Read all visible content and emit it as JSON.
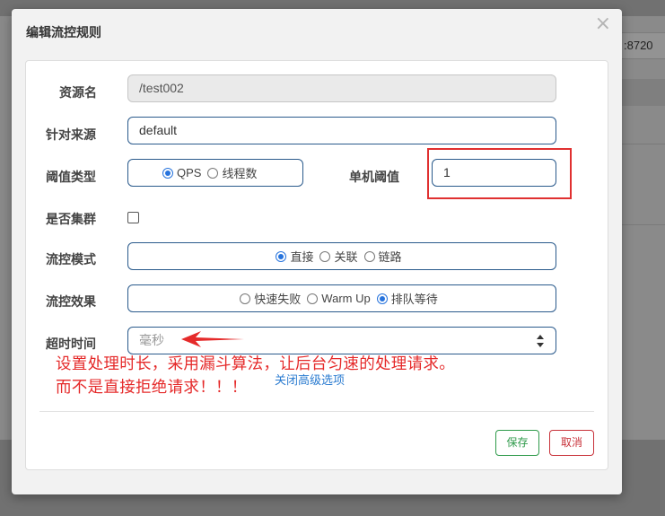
{
  "background": {
    "address_fragment": ":8720"
  },
  "dialog": {
    "title": "编辑流控规则",
    "close_glyph": "×",
    "fields": {
      "resource_name": {
        "label": "资源名",
        "value": "/test002"
      },
      "limit_app": {
        "label": "针对来源",
        "value": "default"
      },
      "grade": {
        "label": "阈值类型",
        "options": [
          "QPS",
          "线程数"
        ],
        "selected": "QPS"
      },
      "count": {
        "label": "单机阈值",
        "value": "1"
      },
      "cluster": {
        "label": "是否集群",
        "checked": false
      },
      "strategy": {
        "label": "流控模式",
        "options": [
          "直接",
          "关联",
          "链路"
        ],
        "selected": "直接"
      },
      "control_behavior": {
        "label": "流控效果",
        "options": [
          "快速失败",
          "Warm Up",
          "排队等待"
        ],
        "selected": "排队等待"
      },
      "timeout": {
        "label": "超时时间",
        "placeholder": "毫秒"
      }
    },
    "annotation_lines": [
      "设置处理时长，采用漏斗算法，让后台匀速的处理请求。",
      "而不是直接拒绝请求！！！"
    ],
    "advanced_link": "关闭高级选项",
    "buttons": {
      "save": "保存",
      "cancel": "取消"
    }
  },
  "colors": {
    "annotation_red": "#e52a2a",
    "radio_blue": "#2673dd",
    "save_green": "#2e9a4a",
    "cancel_red": "#c8323a",
    "link_blue": "#2a7bd0"
  }
}
